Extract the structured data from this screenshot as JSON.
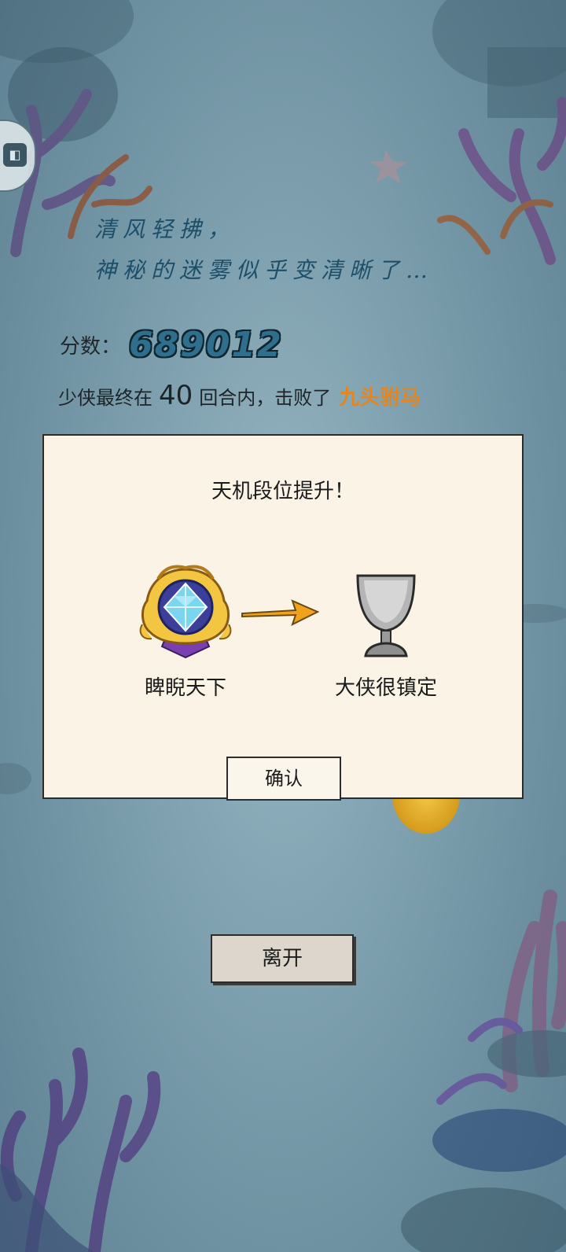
{
  "poem": {
    "line1": "清风轻拂，",
    "line2": "神秘的迷雾似乎变清晰了…"
  },
  "score": {
    "label": "分数：",
    "value": "689012"
  },
  "result": {
    "prefix": "少侠最终在",
    "rounds": "40",
    "middle": "回合内，击败了",
    "boss": "九头驸马"
  },
  "dialog": {
    "title": "天机段位提升！",
    "from_rank": "睥睨天下",
    "to_rank": "大侠很镇定",
    "confirm_label": "确认"
  },
  "leave_label": "离开",
  "colors": {
    "boss_text": "#e18622",
    "score_fill": "#2f6f8e",
    "poem_text": "#1d4f6a"
  }
}
